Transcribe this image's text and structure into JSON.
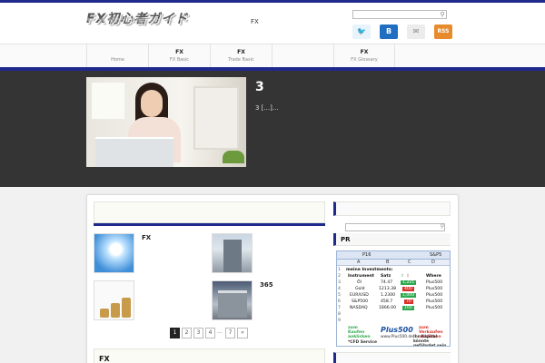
{
  "header": {
    "logo": "FX初心者ガイド",
    "tagline": "FX",
    "social": {
      "twitter": "🐦",
      "hatena": "B",
      "mail": "✉",
      "rss": "RSS"
    }
  },
  "nav": {
    "items": [
      {
        "title": "",
        "sub": "Home"
      },
      {
        "title": "FX",
        "sub": "FX Basic"
      },
      {
        "title": "FX",
        "sub": "Trade Basic"
      },
      {
        "title": "",
        "sub": ""
      },
      {
        "title": "FX",
        "sub": "FX Glossary"
      }
    ]
  },
  "hero": {
    "title": "3",
    "excerpt": "3 [...]..."
  },
  "posts": [
    {
      "title": "FX"
    },
    {
      "title": ""
    },
    {
      "title": ""
    },
    {
      "title": "365"
    }
  ],
  "pagination": {
    "pages": [
      "1",
      "2",
      "3",
      "4"
    ],
    "dots": "...",
    "last": "7",
    "next": "»",
    "current": "1"
  },
  "section2": {
    "label": "FX"
  },
  "sidebar": {
    "pr_label": "PR"
  },
  "sheet": {
    "cell_ref": "P16",
    "formula_tag": "S&P5",
    "cols": [
      "A",
      "B",
      "C",
      "D"
    ],
    "heading": "meine Investments:",
    "columns": [
      "Instrument",
      "Satz",
      "",
      "Where"
    ],
    "rows": [
      {
        "n": "3",
        "name": "Öl",
        "rate": "74.47",
        "val": "1,221",
        "dir": "up",
        "where": "Plus500"
      },
      {
        "n": "4",
        "name": "Gold",
        "rate": "1213.38",
        "val": "400",
        "dir": "down",
        "where": "Plus500"
      },
      {
        "n": "5",
        "name": "EUR/USD",
        "rate": "1.2300",
        "val": "1,000",
        "dir": "up",
        "where": "Plus500"
      },
      {
        "n": "6",
        "name": "S&P500",
        "rate": "458.7",
        "val": "70",
        "dir": "down",
        "where": "Plus500"
      },
      {
        "n": "7",
        "name": "NASDAQ",
        "rate": "1866.00",
        "val": "100",
        "dir": "up",
        "where": "Plus500"
      }
    ],
    "ad_left": "zum Kaufen anklicken",
    "ad_brand": "Plus500",
    "ad_right": "zum Verkaufen anklicken",
    "ad_url": "www.Plus500.de",
    "ad_warning": "Ihr Kapital könnte gefährdet sein",
    "ad_service": "*CFD Service"
  }
}
